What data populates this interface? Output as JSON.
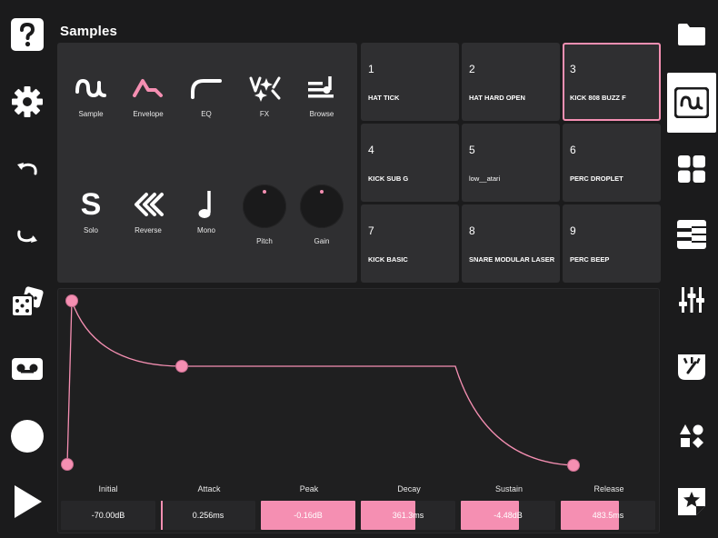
{
  "app": {
    "title": "Samples"
  },
  "colors": {
    "accent": "#f58fb2",
    "background": "#1b1b1c",
    "panel": "#2f2f31"
  },
  "left_toolbar": [
    {
      "name": "help-icon"
    },
    {
      "name": "settings-gear-icon"
    },
    {
      "name": "undo-icon"
    },
    {
      "name": "redo-icon"
    },
    {
      "name": "dice-icon"
    },
    {
      "name": "tape-icon"
    },
    {
      "name": "record-icon"
    },
    {
      "name": "play-icon"
    }
  ],
  "right_toolbar": [
    {
      "name": "folder-icon",
      "active": false
    },
    {
      "name": "waveform-icon",
      "active": true
    },
    {
      "name": "grid-icon",
      "active": false
    },
    {
      "name": "keyboard-icon",
      "active": false
    },
    {
      "name": "mixer-icon",
      "active": false
    },
    {
      "name": "gauge-icon",
      "active": false
    },
    {
      "name": "shapes-icon",
      "active": false
    },
    {
      "name": "star-sticker-icon",
      "active": false
    }
  ],
  "tools": {
    "sample": "Sample",
    "envelope": "Envelope",
    "eq": "EQ",
    "fx": "FX",
    "browse": "Browse",
    "solo": "Solo",
    "solo_glyph": "S",
    "reverse": "Reverse",
    "mono": "Mono",
    "pitch": "Pitch",
    "gain": "Gain"
  },
  "pads": [
    {
      "num": "1",
      "name": "HAT TICK",
      "selected": false
    },
    {
      "num": "2",
      "name": "HAT HARD OPEN",
      "selected": false
    },
    {
      "num": "3",
      "name": "KICK 808 BUZZ F",
      "selected": true
    },
    {
      "num": "4",
      "name": "KICK SUB G",
      "selected": false
    },
    {
      "num": "5",
      "name": "low__atari",
      "selected": false
    },
    {
      "num": "6",
      "name": "PERC DROPLET",
      "selected": false
    },
    {
      "num": "7",
      "name": "KICK BASIC",
      "selected": false
    },
    {
      "num": "8",
      "name": "SNARE MODULAR LASER",
      "selected": false
    },
    {
      "num": "9",
      "name": "PERC BEEP",
      "selected": false
    }
  ],
  "envelope": {
    "params": [
      {
        "label": "Initial",
        "value": "-70.00dB",
        "fill": 0.0
      },
      {
        "label": "Attack",
        "value": "0.256ms",
        "fill": 0.0
      },
      {
        "label": "Peak",
        "value": "-0.16dB",
        "fill": 1.0
      },
      {
        "label": "Decay",
        "value": "361.3ms",
        "fill": 0.58
      },
      {
        "label": "Sustain",
        "value": "-4.48dB",
        "fill": 0.62
      },
      {
        "label": "Release",
        "value": "483.5ms",
        "fill": 0.62
      }
    ]
  }
}
